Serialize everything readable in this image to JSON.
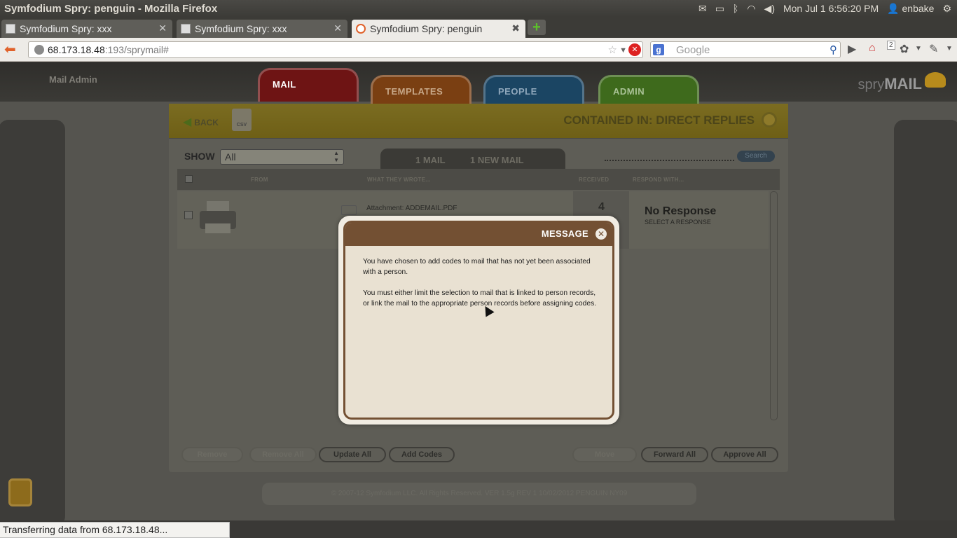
{
  "os": {
    "window_title": "Symfodium Spry: penguin - Mozilla Firefox",
    "clock": "Mon Jul  1  6:56:20 PM",
    "user": "enbake",
    "icons": [
      "mail-icon",
      "battery-icon",
      "bluetooth-icon",
      "wifi-icon",
      "volume-icon",
      "user-icon",
      "settings-gear-icon"
    ]
  },
  "browser": {
    "tabs": [
      {
        "label": "Symfodium Spry: xxx"
      },
      {
        "label": "Symfodium Spry: xxx"
      },
      {
        "label": "Symfodium Spry: penguin"
      }
    ],
    "url_host": "68.173.18.48",
    "url_rest": ":193/sprymail#",
    "search_placeholder": "Google",
    "search_engine_letter": "g",
    "addon_badge": "2",
    "status": "Transferring data from 68.173.18.48..."
  },
  "app": {
    "header_label": "Mail Admin",
    "tabs": [
      {
        "label": "MAIL",
        "color": "#6e1414"
      },
      {
        "label": "TEMPLATES",
        "color": "#7a3f12"
      },
      {
        "label": "PEOPLE",
        "color": "#1b4563"
      },
      {
        "label": "ADMIN",
        "color": "#3e6a1c"
      }
    ],
    "logo_small": "spry",
    "logo_big": "MAIL",
    "back_label": "BACK",
    "csv_label": "CSV",
    "contained_in": "CONTAINED IN: DIRECT REPLIES",
    "show_label": "SHOW",
    "show_value": "All",
    "mail_count": "1 MAIL",
    "new_mail_count": "1 NEW MAIL",
    "search_label": "Search",
    "columns": {
      "from": "FROM",
      "what": "WHAT THEY WROTE...",
      "received": "RECEIVED",
      "respond": "RESPOND WITH..."
    },
    "row": {
      "attachment": "Attachment: ADDEMAIL.PDF",
      "received": "4",
      "response_title": "No Response",
      "response_sub": "SELECT A RESPONSE"
    },
    "buttons": {
      "remove": "Remove",
      "remove_all": "Remove All",
      "update_all": "Update All",
      "add_codes": "Add Codes",
      "move": "Move",
      "forward_all": "Forward All",
      "approve_all": "Approve All"
    },
    "copyright": "© 2007-12 Symfodium LLC. All Rights Reserved. VER 1.5g REV 1 10/02/2012 PENGUIN NY09"
  },
  "modal": {
    "title": "MESSAGE",
    "close_glyph": "✕",
    "paragraph1": "You have chosen to add codes to mail that has not yet been associated with a person.",
    "paragraph2": "You must either limit the selection to mail that is linked to person records, or link the mail to the appropriate person records before assigning codes."
  }
}
